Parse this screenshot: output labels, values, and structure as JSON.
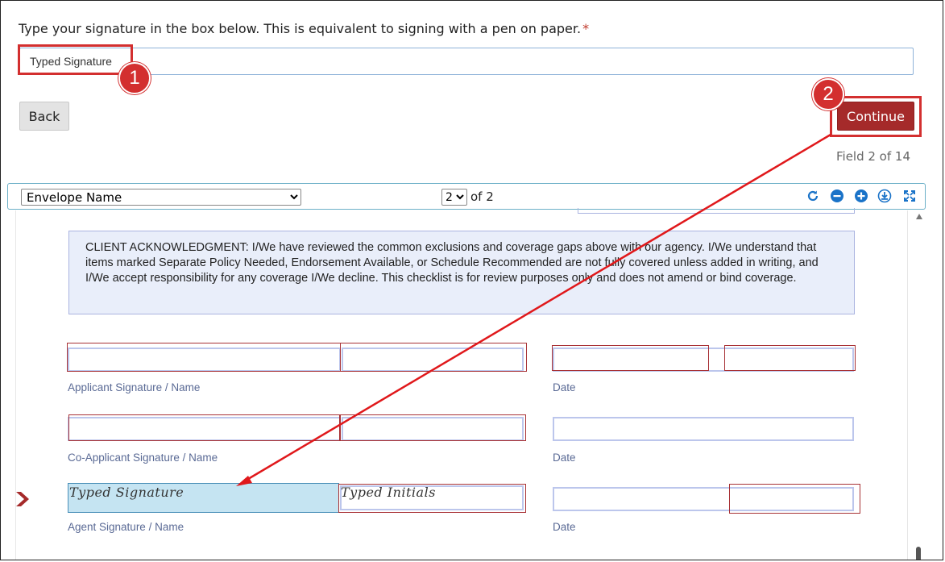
{
  "instruction": "Type your signature in the box below. This is equivalent to signing with a pen on paper.",
  "required_mark": "*",
  "signature_input": {
    "value": "Typed Signature",
    "placeholder": ""
  },
  "callouts": {
    "one": "1",
    "two": "2"
  },
  "buttons": {
    "back": "Back",
    "continue": "Continue"
  },
  "field_count": "Field 2 of 14",
  "toolbar": {
    "envelope_select": "Envelope Name",
    "page_select": "2",
    "page_of": "of 2",
    "icons": [
      "refresh-icon",
      "zoom-out-icon",
      "zoom-in-icon",
      "download-icon",
      "fullscreen-icon"
    ]
  },
  "document": {
    "acknowledgment": "CLIENT ACKNOWLEDGMENT: I/We have reviewed the common exclusions and coverage gaps above with our agency. I/We understand that items marked Separate Policy Needed, Endorsement Available, or Schedule Recommended are not fully covered unless added in writing, and I/We accept responsibility for any coverage I/We decline. This checklist is for review purposes only and does not amend or bind coverage.",
    "labels": {
      "applicant": "Applicant Signature / Name",
      "co_applicant": "Co-Applicant Signature / Name",
      "agent": "Agent Signature / Name",
      "date": "Date"
    },
    "agent_signature": "Typed Signature",
    "agent_initials": "Typed Initials"
  },
  "colors": {
    "accent_red": "#d32f2f",
    "continue_bg": "#a52a2a",
    "field_border": "#bcc6ec",
    "signature_fill": "#c5e4f2"
  }
}
